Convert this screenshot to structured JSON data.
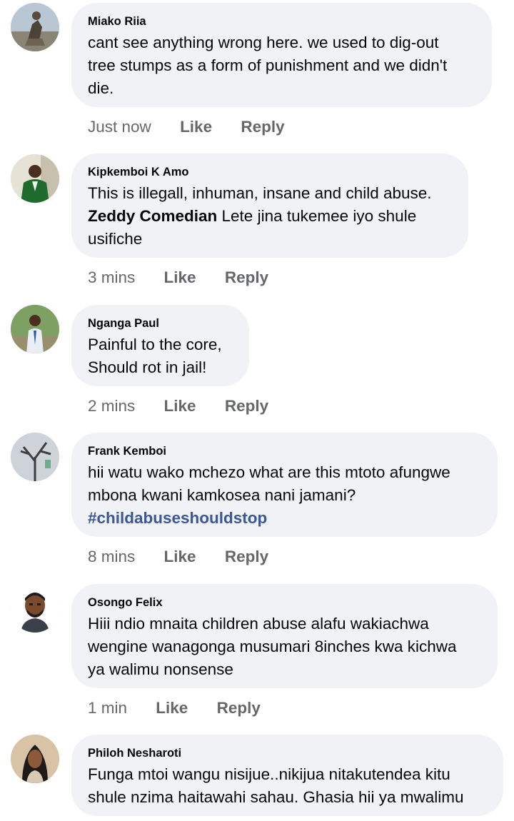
{
  "comments": [
    {
      "author": "Miako Riia",
      "avatar_icon": "person-photo-avatar",
      "text_lines": [
        "cant see anything wrong here. we used to dig-out",
        "tree stumps as a form of punishment and we didn't",
        "die."
      ],
      "time": "Just now",
      "like_label": "Like",
      "reply_label": "Reply"
    },
    {
      "author": "Kipkemboi K Amo",
      "avatar_icon": "person-photo-avatar",
      "text_line1": "This is illegall, inhuman, insane and child abuse.",
      "mention": "Zeddy Comedian",
      "text_line2_rest": " Lete jina tukemee iyo shule",
      "text_line3": "usifiche",
      "time": "3 mins",
      "like_label": "Like",
      "reply_label": "Reply"
    },
    {
      "author": "Nganga Paul",
      "avatar_icon": "person-photo-avatar",
      "text_lines": [
        "Painful to the core,",
        "Should rot in jail!"
      ],
      "time": "2 mins",
      "like_label": "Like",
      "reply_label": "Reply"
    },
    {
      "author": "Frank Kemboi",
      "avatar_icon": "tree-photo-avatar",
      "text_lines": [
        "hii watu wako mchezo what are this mtoto afungwe",
        "mbona kwani kamkosea nani jamani?"
      ],
      "hashtag": "#childabuseshouldstop",
      "time": "8 mins",
      "like_label": "Like",
      "reply_label": "Reply"
    },
    {
      "author": "Osongo Felix",
      "avatar_icon": "cartoon-avatar",
      "text_lines": [
        "Hiii ndio mnaita children abuse alafu wakiachwa",
        "wengine wanagonga musumari 8inches kwa kichwa",
        "ya walimu nonsense"
      ],
      "time": "1 min",
      "like_label": "Like",
      "reply_label": "Reply"
    },
    {
      "author": "Philoh Nesharoti",
      "avatar_icon": "person-photo-avatar",
      "text_lines": [
        "Funga mtoi wangu nisijue..nikijua nitakutendea kitu",
        "shule nzima haitawahi sahau. Ghasia hii ya mwalimu"
      ]
    }
  ],
  "colors": {
    "bubble": "#f0f2f5",
    "secondary_text": "#65676b",
    "hashtag": "#385898"
  }
}
